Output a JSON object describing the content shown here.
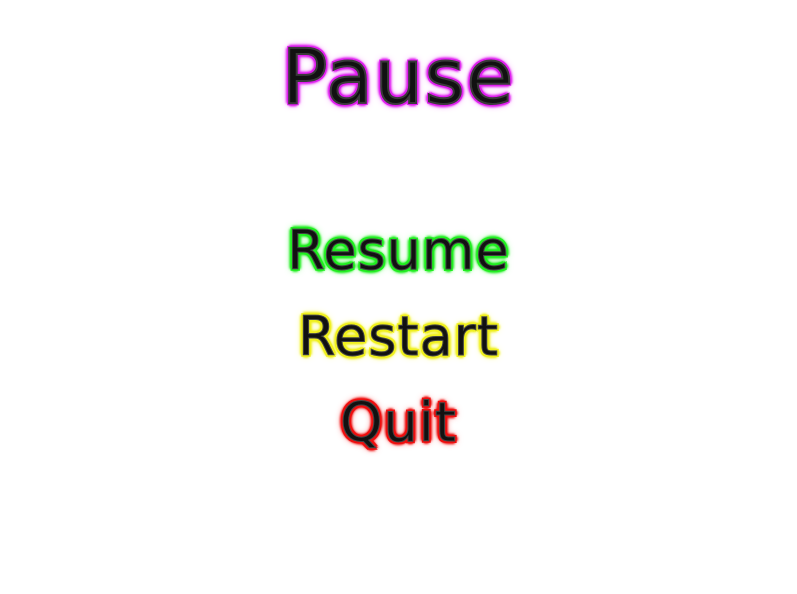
{
  "title": {
    "label": "Pause",
    "glow_color": "#e020f0"
  },
  "menu": {
    "items": [
      {
        "label": "Resume",
        "glow_color": "#22ee22"
      },
      {
        "label": "Restart",
        "glow_color": "#f0f020"
      },
      {
        "label": "Quit",
        "glow_color": "#ee1111"
      }
    ]
  }
}
